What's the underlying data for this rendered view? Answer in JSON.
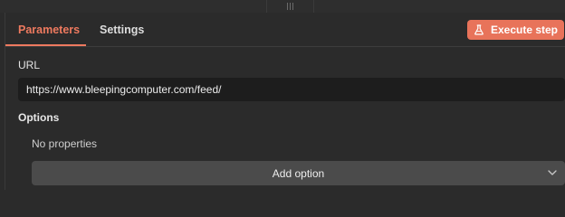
{
  "tabs": [
    {
      "label": "Parameters",
      "active": true
    },
    {
      "label": "Settings",
      "active": false
    }
  ],
  "execute_button": {
    "label": "Execute step",
    "icon": "flask-icon"
  },
  "url_field": {
    "label": "URL",
    "value": "https://www.bleepingcomputer.com/feed/"
  },
  "options": {
    "label": "Options",
    "empty_text": "No properties",
    "add_button_label": "Add option",
    "add_button_icon": "chevron-down-icon"
  },
  "colors": {
    "accent": "#ee7a5f",
    "button": "#e8735a",
    "background": "#2b2b2b",
    "input_background": "#1d1d1d",
    "add_option_background": "#4b4b4b"
  }
}
